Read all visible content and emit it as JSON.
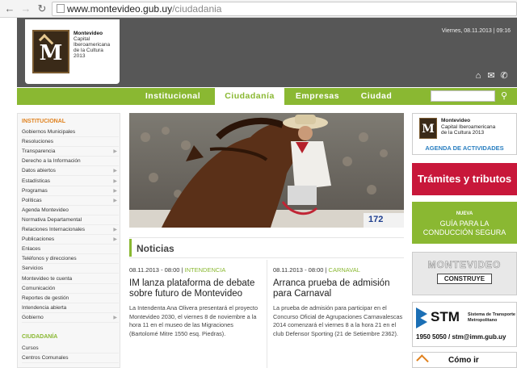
{
  "browser": {
    "url_host": "www.montevideo.gub.uy",
    "url_path": "/ciudadania"
  },
  "header": {
    "logo_lines": [
      "Montevideo",
      "Capital",
      "Iberoamericana",
      "de la Cultura",
      "2013"
    ],
    "logo_letter": "M",
    "datetime": "Viernes, 08.11.2013 | 09:16"
  },
  "nav": {
    "tabs": [
      "Institucional",
      "Ciudadanía",
      "Empresas",
      "Ciudad"
    ],
    "active": "Ciudadanía"
  },
  "sidebar": {
    "section1_title": "INSTITUCIONAL",
    "section1_items": [
      {
        "label": "Gobiernos Municipales",
        "arrow": false
      },
      {
        "label": "Resoluciones",
        "arrow": false
      },
      {
        "label": "Transparencia",
        "arrow": true
      },
      {
        "label": "Derecho a la Información",
        "arrow": false
      },
      {
        "label": "Datos abiertos",
        "arrow": true
      },
      {
        "label": "Estadísticas",
        "arrow": true
      },
      {
        "label": "Programas",
        "arrow": true
      },
      {
        "label": "Políticas",
        "arrow": true
      },
      {
        "label": "Agenda Montevideo",
        "arrow": false
      },
      {
        "label": "Normativa Departamental",
        "arrow": false
      },
      {
        "label": "Relaciones Internacionales",
        "arrow": true
      },
      {
        "label": "Publicaciones",
        "arrow": true
      },
      {
        "label": "Enlaces",
        "arrow": false
      },
      {
        "label": "Teléfonos y direcciones",
        "arrow": false
      },
      {
        "label": "Servicios",
        "arrow": false
      },
      {
        "label": "Montevideo te cuenta",
        "arrow": false
      },
      {
        "label": "Comunicación",
        "arrow": false
      },
      {
        "label": "Reportes de gestión",
        "arrow": false
      },
      {
        "label": "Intendencia abierta",
        "arrow": false
      },
      {
        "label": "Gobierno",
        "arrow": true
      }
    ],
    "section2_title": "CIUDADANÍA",
    "section2_items": [
      {
        "label": "Cursos",
        "arrow": false
      },
      {
        "label": "Centros Comunales",
        "arrow": false
      }
    ]
  },
  "hero": {
    "sign_number": "172"
  },
  "news": {
    "heading": "Noticias",
    "articles": [
      {
        "date": "08.11.2013 - 08:00",
        "category": "INTENDENCIA",
        "title": "IM lanza plataforma de debate sobre futuro de Montevideo",
        "body": "La Intendenta Ana Olivera presentará el proyecto Montevideo 2030, el viernes 8 de noviembre a la hora 11 en el museo de las Migraciones (Bartolomé Mitre 1550 esq. Piedras)."
      },
      {
        "date": "08.11.2013 - 08:00",
        "category": "CARNAVAL",
        "title": "Arranca prueba de admisión para Carnaval",
        "body": "La prueba de admisión para participar en el Concurso Oficial de Agrupaciones Carnavalescas 2014 comenzará el viernes 8 a la hora 21 en el club Defensor Sporting (21 de Setiembre 2362)."
      }
    ]
  },
  "right": {
    "agenda_logo_lines": [
      "Montevideo",
      "Capital Iberoamericana",
      "de la Cultura 2013"
    ],
    "agenda_label": "AGENDA DE ACTIVIDADES",
    "tramites": "Trámites y tributos",
    "guia_new": "NUEVA",
    "guia_lines": [
      "GUÍA PARA LA",
      "CONDUCCIÓN SEGURA"
    ],
    "construye_title": "MONTEVIDEO",
    "construye_label": "CONSTRUYE",
    "stm_name": "STM",
    "stm_desc": [
      "Sistema de Transporte",
      "Metropolitano"
    ],
    "stm_contact": "1950 5050 / stm@imm.gub.uy",
    "como_ir": "Cómo ir"
  },
  "colors": {
    "green": "#8ab832",
    "orange": "#e0811d",
    "red": "#c8173a",
    "header_gray": "#575757"
  }
}
